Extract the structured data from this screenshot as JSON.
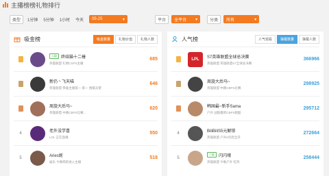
{
  "header": {
    "title": "主播榜榜礼物排行"
  },
  "filters": {
    "label_type": "类型",
    "time_tabs": [
      "1分钟",
      "5分钟",
      "1小时",
      "今天"
    ],
    "date_value": "05-25",
    "platform_label": "平台",
    "platform_value": "全平台",
    "sort_label": "分类",
    "sort_value": "所有"
  },
  "left_panel": {
    "title": "吸金榜",
    "tabs": [
      "吸金数量",
      "礼物价值",
      "礼物人数"
    ],
    "rows": [
      {
        "rank": "1",
        "badge": "二级",
        "name": "终结猫十二椿",
        "sub": "英雄联盟 礼物CSPS主播",
        "value": "685"
      },
      {
        "rank": "2",
        "badge": "",
        "name": "新仍丶飞天喵",
        "sub": "英雄联盟 恭喜主播第一 第一 围棋天使",
        "value": "646"
      },
      {
        "rank": "3",
        "badge": "",
        "name": "周旋大后马~",
        "sub": "英雄联盟 中路CBPS比赛...",
        "value": "620"
      },
      {
        "rank": "4",
        "badge": "",
        "name": "老外没学喜",
        "sub": "LOL 正在直播",
        "value": "550"
      },
      {
        "rank": "5",
        "badge": "",
        "name": "Aries妮",
        "sub": "娱乐 今晚萌新进入主播",
        "value": "518"
      }
    ]
  },
  "right_panel": {
    "title": "人气榜",
    "tabs": [
      "人气观看",
      "弹幕数量",
      "弹幕人数"
    ],
    "rows": [
      {
        "rank": "1",
        "avatar_text": "LPL",
        "badge": "",
        "name": "S7英雄联盟全球总决赛",
        "sub": "英雄联盟 英雄联盟S7全球总决赛",
        "value": "366966"
      },
      {
        "rank": "2",
        "avatar_text": "",
        "badge": "",
        "name": "周旋大后马~",
        "sub": "英雄联盟 中路CBPS比赛",
        "value": "298925"
      },
      {
        "rank": "3",
        "avatar_text": "",
        "badge": "",
        "name": "韩国最~新手Sama",
        "sub": "户外 战狼最新CBPS跑酷",
        "value": "295712"
      },
      {
        "rank": "4",
        "avatar_text": "",
        "badge": "",
        "name": "BiliBiliS5元解锁",
        "sub": "英雄联盟 户外8点后全开",
        "value": "272664"
      },
      {
        "rank": "5",
        "avatar_text": "",
        "badge": "二级",
        "name": "闪闪魂",
        "sub": "英雄联盟 今晚户外 吃鸡",
        "value": "258444"
      }
    ]
  },
  "colors": {
    "accent": "#f47a20",
    "blue": "#3aa0d8"
  }
}
